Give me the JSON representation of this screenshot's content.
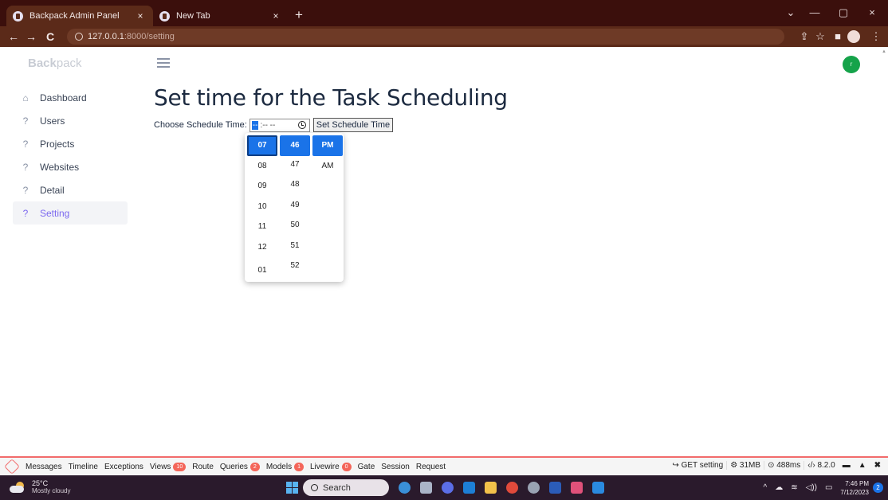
{
  "browser": {
    "tabs": [
      {
        "title": "Backpack Admin Panel",
        "close": "×",
        "active": true
      },
      {
        "title": "New Tab",
        "close": "×",
        "active": false
      }
    ],
    "new_tab": "+",
    "window_controls": {
      "dropdown": "⌄",
      "minimize": "—",
      "restore": "▢",
      "close": "×"
    },
    "address": {
      "host": "127.0.0.1",
      "path": ":8000/setting"
    },
    "icons": {
      "back": "←",
      "forward": "→",
      "reload": "C",
      "share": "⇪",
      "bookmark": "☆",
      "sidepanel": "■",
      "menu": "⋮"
    }
  },
  "app": {
    "brand_bold": "Back",
    "brand_light": "pack",
    "avatar_letter": "r"
  },
  "sidebar": {
    "items": [
      {
        "label": "Dashboard",
        "icon": "home-icon",
        "glyph": "⌂"
      },
      {
        "label": "Users",
        "icon": "question-icon",
        "glyph": "?"
      },
      {
        "label": "Projects",
        "icon": "question-icon",
        "glyph": "?"
      },
      {
        "label": "Websites",
        "icon": "question-icon",
        "glyph": "?"
      },
      {
        "label": "Detail",
        "icon": "question-icon",
        "glyph": "?"
      },
      {
        "label": "Setting",
        "icon": "question-icon",
        "glyph": "?",
        "active": true
      }
    ]
  },
  "main": {
    "title": "Set time for the Task Scheduling",
    "form": {
      "label": "Choose Schedule Time:",
      "time_value_segment": "--",
      "time_value_rest": ":-- --",
      "submit": "Set Schedule Time"
    },
    "picker": {
      "hours": [
        "07",
        "08",
        "09",
        "10",
        "11",
        "12",
        "01"
      ],
      "minutes": [
        "46",
        "47",
        "48",
        "49",
        "50",
        "51",
        "52"
      ],
      "ampm": [
        "PM",
        "AM"
      ],
      "selected": {
        "hour": "07",
        "minute": "46",
        "ampm": "PM"
      }
    }
  },
  "debugbar": {
    "tabs": [
      {
        "label": "Messages"
      },
      {
        "label": "Timeline"
      },
      {
        "label": "Exceptions"
      },
      {
        "label": "Views",
        "badge": "10"
      },
      {
        "label": "Route"
      },
      {
        "label": "Queries",
        "badge": "2"
      },
      {
        "label": "Models",
        "badge": "1"
      },
      {
        "label": "Livewire",
        "badge": "0"
      },
      {
        "label": "Gate"
      },
      {
        "label": "Session"
      },
      {
        "label": "Request"
      }
    ],
    "right": {
      "route": "↪ GET setting",
      "memory": "⚙ 31MB",
      "time": "⊙ 488ms",
      "php": "‹/› 8.2.0"
    },
    "controls": {
      "folder": "▬",
      "expand": "▲",
      "close": "✖"
    },
    "accent": "#f26b6b"
  },
  "taskbar": {
    "weather_temp": "25°C",
    "weather_desc": "Mostly cloudy",
    "search_placeholder": "Search",
    "tray": {
      "chevron": "^",
      "cloud": "☁",
      "wifi": "≋",
      "volume": "◁))",
      "battery": "▭"
    },
    "time": "7:46 PM",
    "date": "7/12/2023",
    "notifications": "2"
  },
  "colors": {
    "accent": "#7c69ef",
    "select_blue": "#1a73e8",
    "avatar": "#15a34a",
    "tab_strip": "#3b0f0c",
    "toolbar": "#5b2a19"
  }
}
